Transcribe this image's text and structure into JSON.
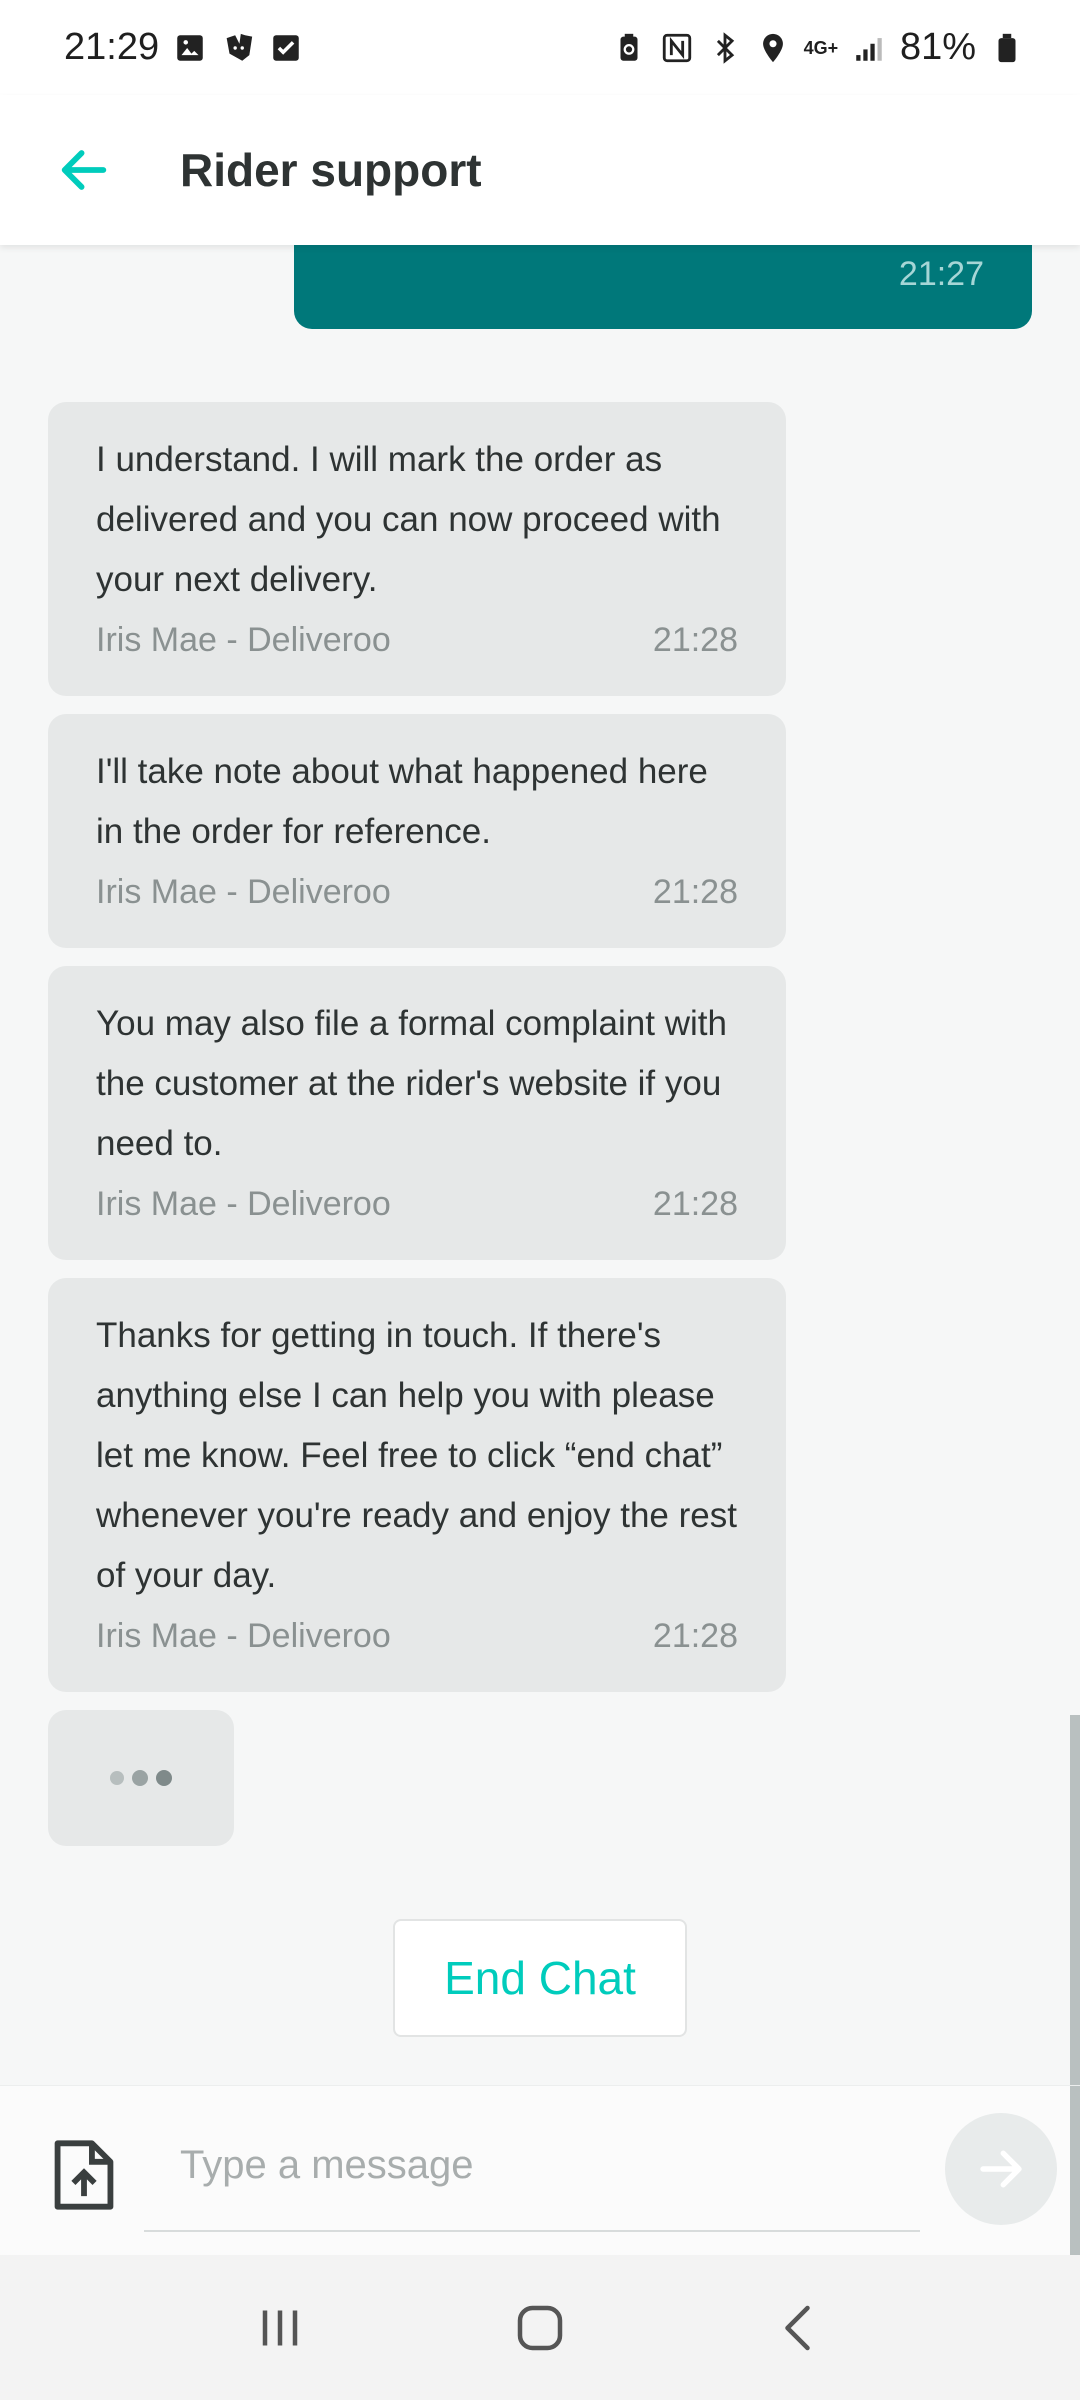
{
  "status_bar": {
    "time": "21:29",
    "network": "4G+",
    "battery": "81%",
    "left_icons": [
      "image-icon",
      "deliveroo-icon",
      "checkbox-icon"
    ],
    "right_icons": [
      "battery-saver-icon",
      "nfc-icon",
      "bluetooth-icon",
      "location-icon",
      "network-4g-icon",
      "signal-icon",
      "battery-icon"
    ]
  },
  "header": {
    "title": "Rider support",
    "back_icon": "arrow-left-icon"
  },
  "chat": {
    "outgoing_time": "21:27",
    "messages": [
      {
        "text": "I understand. I will mark the order as delivered and you can now proceed with your next delivery.",
        "sender": "Iris Mae - Deliveroo",
        "time": "21:28"
      },
      {
        "text": "I'll take note about what happened here in the order for reference.",
        "sender": "Iris Mae - Deliveroo",
        "time": "21:28"
      },
      {
        "text": "You may also file a formal complaint with the customer at the rider's website if you need to.",
        "sender": "Iris Mae - Deliveroo",
        "time": "21:28"
      },
      {
        "text": "Thanks for getting in touch. If there's anything else I can help you with please let me know. Feel free to click “end chat” whenever you're ready and enjoy the rest of your day.",
        "sender": "Iris Mae - Deliveroo",
        "time": "21:28"
      }
    ],
    "end_chat_label": "End Chat"
  },
  "composer": {
    "placeholder": "Type a message",
    "value": "",
    "attach_icon": "file-upload-icon",
    "send_icon": "arrow-right-icon"
  },
  "colors": {
    "accent": "#00ccbc",
    "outgoing_bubble": "#00787a",
    "incoming_bubble": "#e6e8e8",
    "text": "#2e3333",
    "meta_text": "#8a9191"
  },
  "nav_bar": {
    "buttons": [
      "recents-icon",
      "home-icon",
      "back-icon"
    ]
  }
}
